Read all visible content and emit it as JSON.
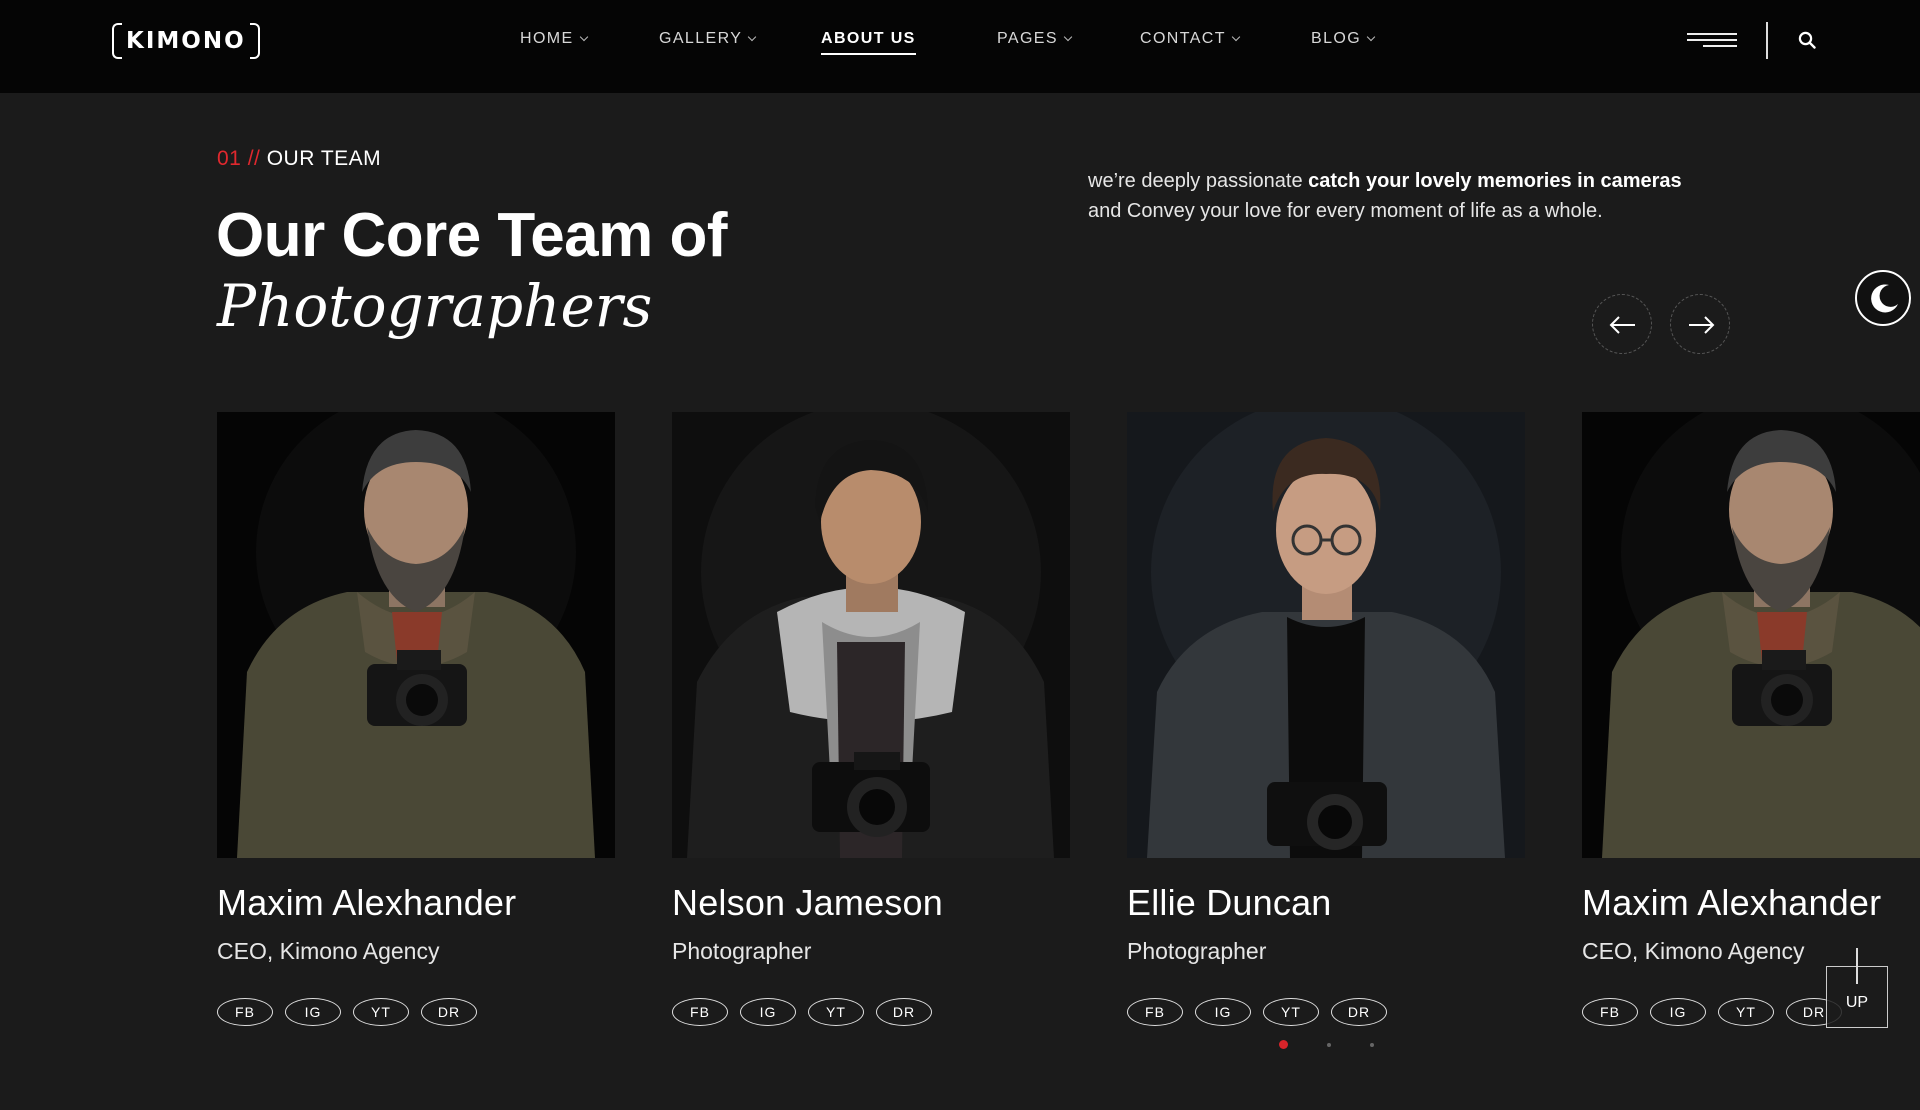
{
  "header": {
    "logo": "KIMONO",
    "nav": [
      {
        "label": "HOME",
        "dropdown": true
      },
      {
        "label": "GALLERY",
        "dropdown": true
      },
      {
        "label": "ABOUT US",
        "dropdown": false,
        "active": true
      },
      {
        "label": "PAGES",
        "dropdown": true
      },
      {
        "label": "CONTACT",
        "dropdown": true
      },
      {
        "label": "BLOG",
        "dropdown": true
      }
    ]
  },
  "section": {
    "eyebrow_number": "01 //",
    "eyebrow_label": "OUR TEAM",
    "title_line1": "Our Core Team of",
    "title_line2": "Photographers",
    "intro_prefix": "we’re deeply passionate ",
    "intro_bold": "catch your lovely memories in cameras",
    "intro_suffix": "and Convey your love for every moment of life as a whole."
  },
  "team": [
    {
      "name": "Maxim Alexhander",
      "role": "CEO, Kimono Agency",
      "socials": [
        "FB",
        "IG",
        "YT",
        "DR"
      ]
    },
    {
      "name": "Nelson Jameson",
      "role": "Photographer",
      "socials": [
        "FB",
        "IG",
        "YT",
        "DR"
      ]
    },
    {
      "name": "Ellie Duncan",
      "role": "Photographer",
      "socials": [
        "FB",
        "IG",
        "YT",
        "DR"
      ]
    },
    {
      "name": "Maxim Alexhander",
      "role": "CEO, Kimono Agency",
      "socials": [
        "FB",
        "IG",
        "YT",
        "DR"
      ]
    }
  ],
  "slider": {
    "active_dot": 1,
    "dots": 3
  },
  "up_button": "UP",
  "colors": {
    "background": "#1b1b1b",
    "header": "#050505",
    "accent": "#e0282e",
    "text": "#ffffff"
  }
}
